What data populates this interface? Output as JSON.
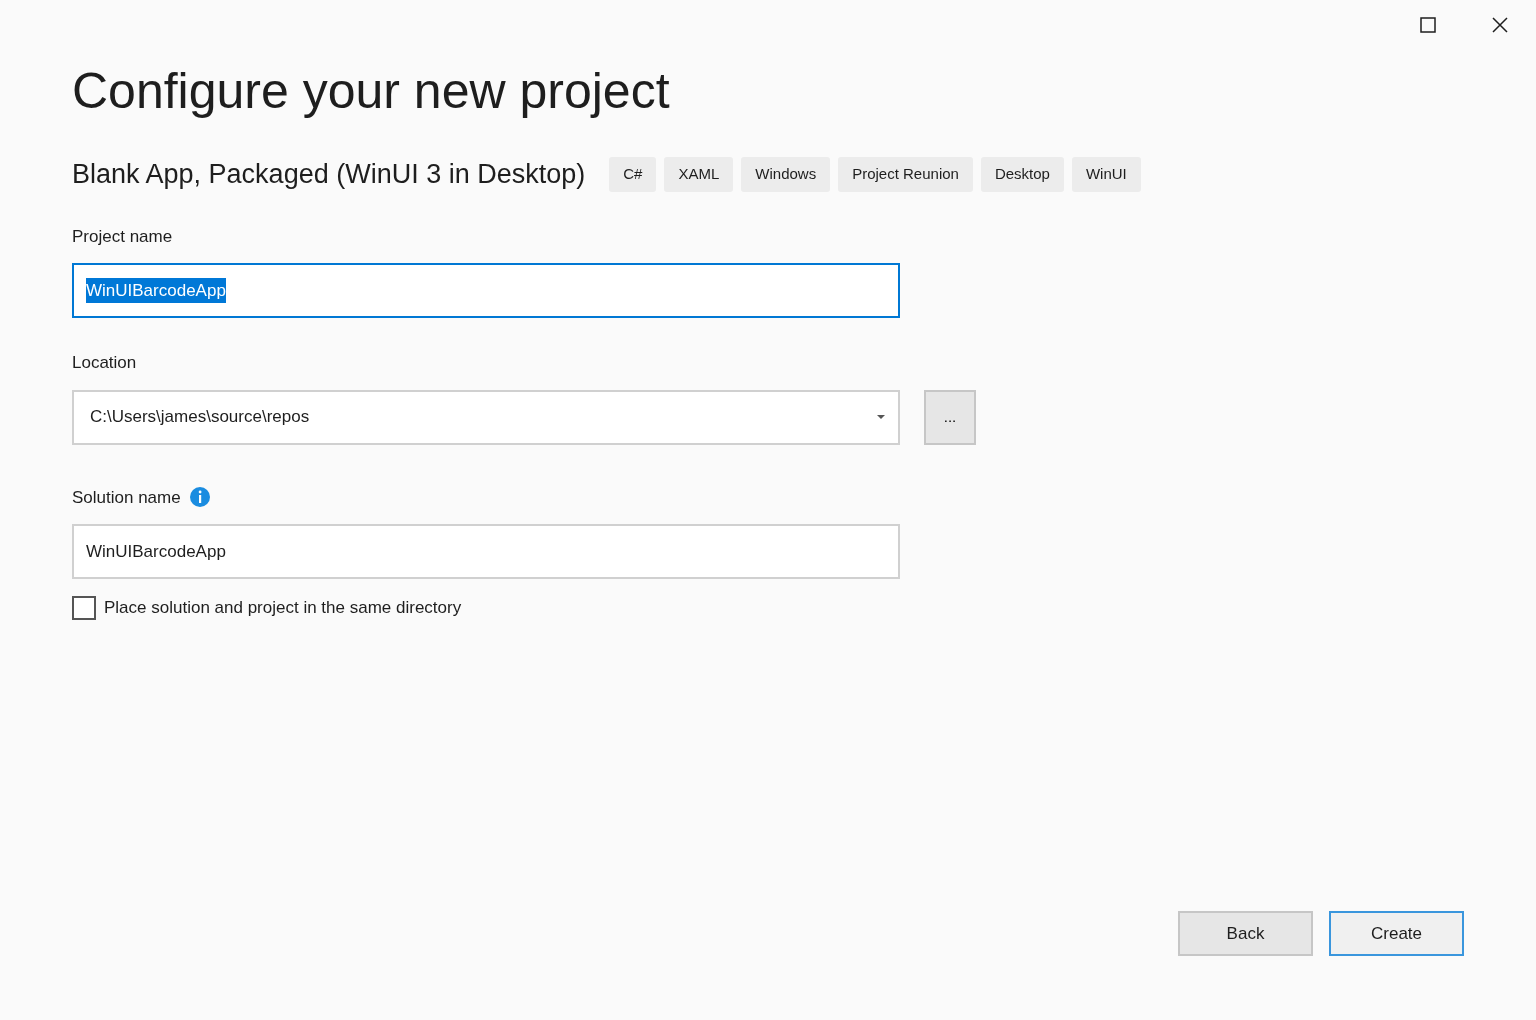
{
  "title": "Configure your new project",
  "template": {
    "name": "Blank App, Packaged (WinUI 3 in Desktop)",
    "tags": [
      "C#",
      "XAML",
      "Windows",
      "Project Reunion",
      "Desktop",
      "WinUI"
    ]
  },
  "project_name": {
    "label": "Project name",
    "value": "WinUIBarcodeApp",
    "focused": true,
    "text_selected": true
  },
  "location": {
    "label": "Location",
    "value": "C:\\Users\\james\\source\\repos",
    "browse_button": "..."
  },
  "solution_name": {
    "label": "Solution name",
    "value": "WinUIBarcodeApp"
  },
  "same_directory": {
    "label": "Place solution and project in the same directory",
    "checked": false
  },
  "buttons": [
    {
      "label": "Back",
      "default": false
    },
    {
      "label": "Create",
      "default": true
    }
  ]
}
